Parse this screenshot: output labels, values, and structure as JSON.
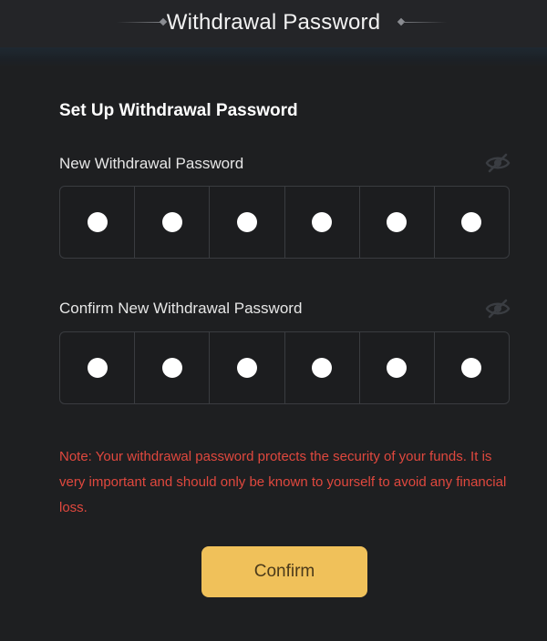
{
  "header": {
    "title": "Withdrawal Password"
  },
  "form": {
    "section_title": "Set Up Withdrawal Password",
    "new_password": {
      "label": "New Withdrawal Password",
      "visibility_icon": "eye-slash-icon",
      "digits_filled": 6
    },
    "confirm_password": {
      "label": "Confirm New Withdrawal Password",
      "visibility_icon": "eye-slash-icon",
      "digits_filled": 6
    },
    "note": "Note: Your withdrawal password protects the security of your funds. It is very important and should only be known to yourself to avoid any financial loss.",
    "confirm_label": "Confirm"
  },
  "colors": {
    "background": "#1e1f21",
    "accent": "#f0c15a",
    "warning": "#e0483e"
  }
}
